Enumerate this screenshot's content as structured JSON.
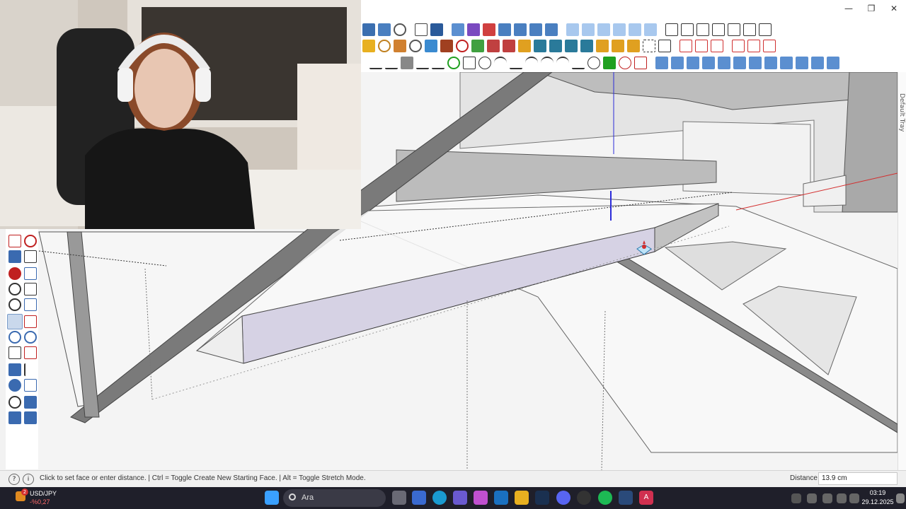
{
  "window": {
    "minimize_glyph": "—",
    "restore_glyph": "❐",
    "close_glyph": "✕"
  },
  "tray": {
    "label": "Default Tray"
  },
  "status": {
    "hint": "Click to set face or enter distance.  |  Ctrl = Toggle Create New Starting Face.  |  Alt = Toggle Stretch Mode.",
    "measurement_label": "Distance",
    "measurement_value": "13.9 cm",
    "help_glyph": "?",
    "info_glyph": "i"
  },
  "taskbar": {
    "ticker_symbol": "USD/JPY",
    "ticker_change": "-%0,27",
    "notification_count": "2",
    "search_placeholder": "Ara",
    "time": "03:19",
    "date": "29.12.2025",
    "app_badge": "A"
  },
  "colors": {
    "accent_red": "#d32f2f",
    "axis_blue": "#2b2bd9",
    "face_selected": "#d6d2e4"
  }
}
